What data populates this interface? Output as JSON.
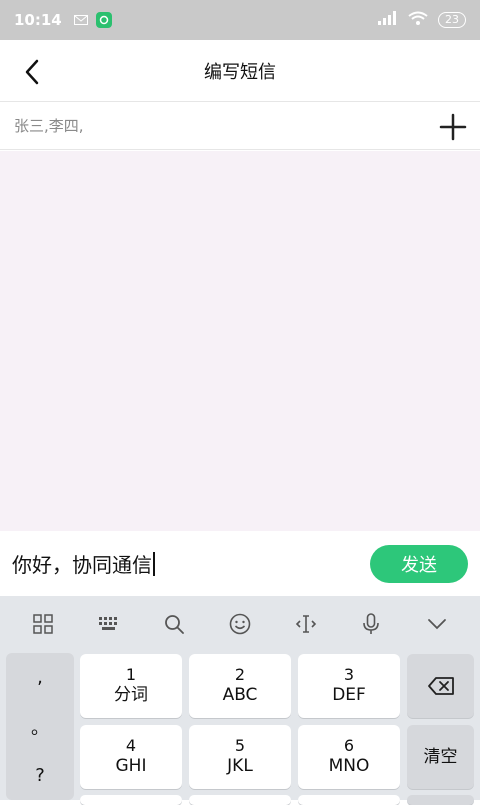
{
  "status_bar": {
    "time": "10:14",
    "battery": "23"
  },
  "header": {
    "title": "编写短信"
  },
  "recipients": {
    "text": "张三,李四,"
  },
  "composer": {
    "text": "你好，协同通信",
    "send_label": "发送"
  },
  "keyboard": {
    "punctuation": [
      ",",
      "。",
      "?"
    ],
    "keys": [
      {
        "num": "1",
        "letters": "分词"
      },
      {
        "num": "2",
        "letters": "ABC"
      },
      {
        "num": "3",
        "letters": "DEF"
      },
      {
        "num": "4",
        "letters": "GHI"
      },
      {
        "num": "5",
        "letters": "JKL"
      },
      {
        "num": "6",
        "letters": "MNO"
      }
    ],
    "clear_label": "清空"
  },
  "colors": {
    "accent": "#2dc77a",
    "messages_bg": "#f7f1f7",
    "keyboard_bg": "#e3e6ea"
  }
}
